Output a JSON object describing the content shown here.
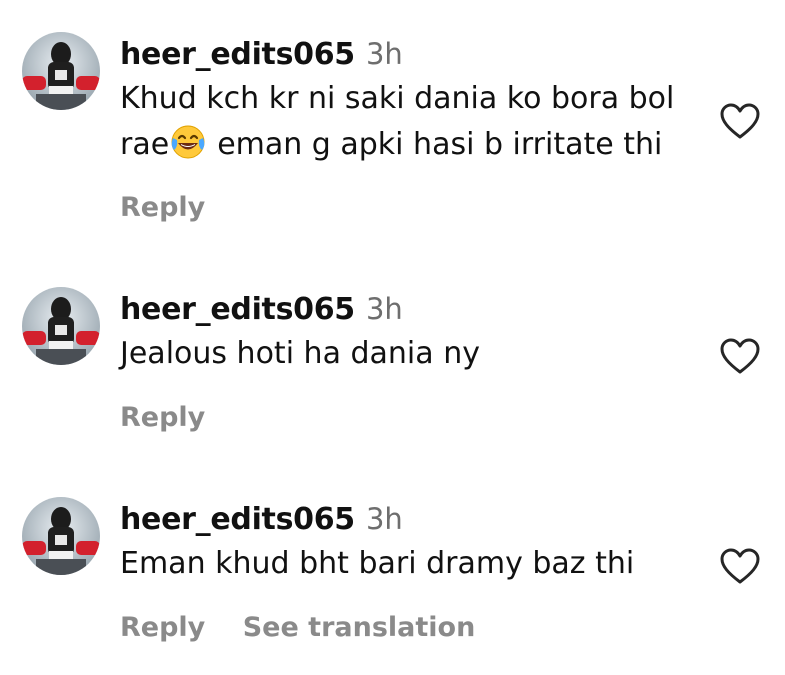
{
  "comments": [
    {
      "username": "heer_edits065",
      "time": "3h",
      "text_line1": "Khud kch kr ni saki dania ko bora bol",
      "text_line2_a": "rae",
      "emoji": "face-with-tears-of-joy",
      "text_line2_b": "eman g apki hasi b irritate thi",
      "reply": "Reply"
    },
    {
      "username": "heer_edits065",
      "time": "3h",
      "text": "Jealous hoti ha dania ny",
      "reply": "Reply"
    },
    {
      "username": "heer_edits065",
      "time": "3h",
      "text": "Eman khud bht bari dramy baz thi",
      "reply": "Reply",
      "see_translation": "See translation"
    }
  ],
  "colors": {
    "username": "#111111",
    "meta": "#6e6e6e",
    "action": "#8a8a8a",
    "heart_stroke": "#262626"
  },
  "icons": {
    "like": "heart-outline-icon"
  }
}
